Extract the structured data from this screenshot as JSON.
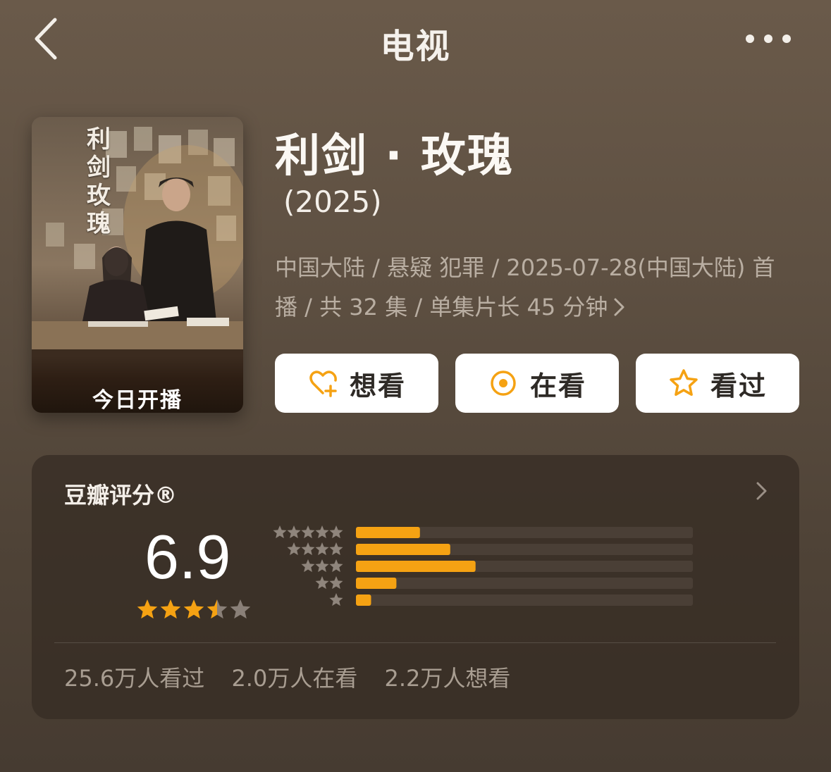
{
  "nav": {
    "title": "电视",
    "back_icon": "chevron-left-icon",
    "more_icon": "ellipsis-icon"
  },
  "poster": {
    "badge": "今日开播",
    "vertical_title": "利剑玫瑰"
  },
  "show": {
    "title": "利剑 · 玫瑰",
    "year": "(2025)",
    "meta_line1": "中国大陆 / 悬疑 犯罪 / 2025-07-28(中国大陆) 首",
    "meta_line2": "播 / 共 32 集 / 单集片长 45 分钟"
  },
  "actions": [
    {
      "label": "想看",
      "icon": "heart-plus-icon"
    },
    {
      "label": "在看",
      "icon": "target-icon"
    },
    {
      "label": "看过",
      "icon": "star-outline-icon"
    }
  ],
  "rating": {
    "title": "豆瓣评分®",
    "score": "6.9",
    "stars_filled": 3.5,
    "stars_total": 5,
    "distribution": [
      {
        "stars": 5,
        "fraction": 0.19
      },
      {
        "stars": 4,
        "fraction": 0.28
      },
      {
        "stars": 3,
        "fraction": 0.355
      },
      {
        "stars": 2,
        "fraction": 0.12
      },
      {
        "stars": 1,
        "fraction": 0.045
      }
    ],
    "stats": [
      "25.6万人看过",
      "2.0万人在看",
      "2.2万人想看"
    ]
  },
  "colors": {
    "accent": "#f5a213",
    "star_empty": "#8a8078",
    "bar_track": "#4a3f36"
  }
}
